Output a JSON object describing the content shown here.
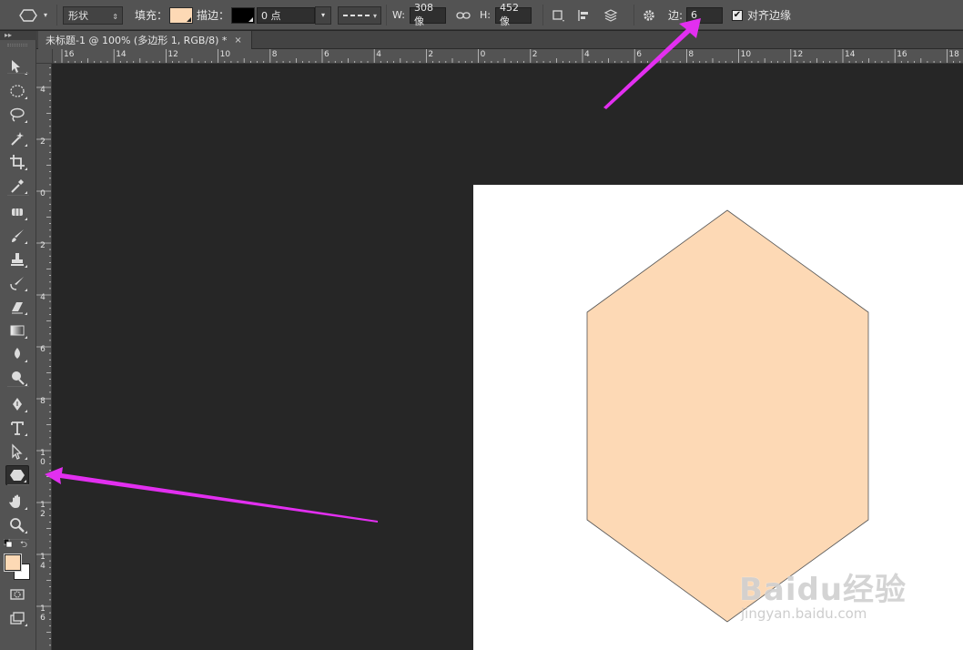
{
  "options_bar": {
    "shape_mode": "形状",
    "fill_label": "填充：",
    "fill_color": "#fdd9b5",
    "stroke_label": "描边：",
    "stroke_color": "#000000",
    "stroke_width": "0 点",
    "w_label": "W:",
    "w_value": "308 像",
    "h_label": "H:",
    "h_value": "452 像",
    "sides_label": "边:",
    "sides_value": "6",
    "align_edges_label": "对齐边缘",
    "align_edges_checked": true
  },
  "document_tab": {
    "title": "未标题-1 @ 100% (多边形 1, RGB/8) *",
    "close": "×"
  },
  "toolbar": {
    "collapse": "▸▸",
    "foreground_color": "#fdd9b5",
    "background_color": "#ffffff",
    "selected_tool": "polygon-tool"
  },
  "ruler_h": [
    "16",
    "14",
    "12",
    "10",
    "8",
    "6",
    "4",
    "2",
    "0",
    "2",
    "4",
    "6",
    "8",
    "10",
    "12",
    "14",
    "16",
    "18"
  ],
  "ruler_v": [
    "4",
    "2",
    "0",
    "2",
    "4",
    "6",
    "8",
    "10",
    "12",
    "14",
    "16"
  ],
  "canvas": {
    "shape_fill": "#fdd9b5",
    "shape_stroke": "#555555",
    "annotation_color": "#e22ff0"
  },
  "watermark": {
    "main": "Baidu经验",
    "sub": "jingyan.baidu.com"
  }
}
